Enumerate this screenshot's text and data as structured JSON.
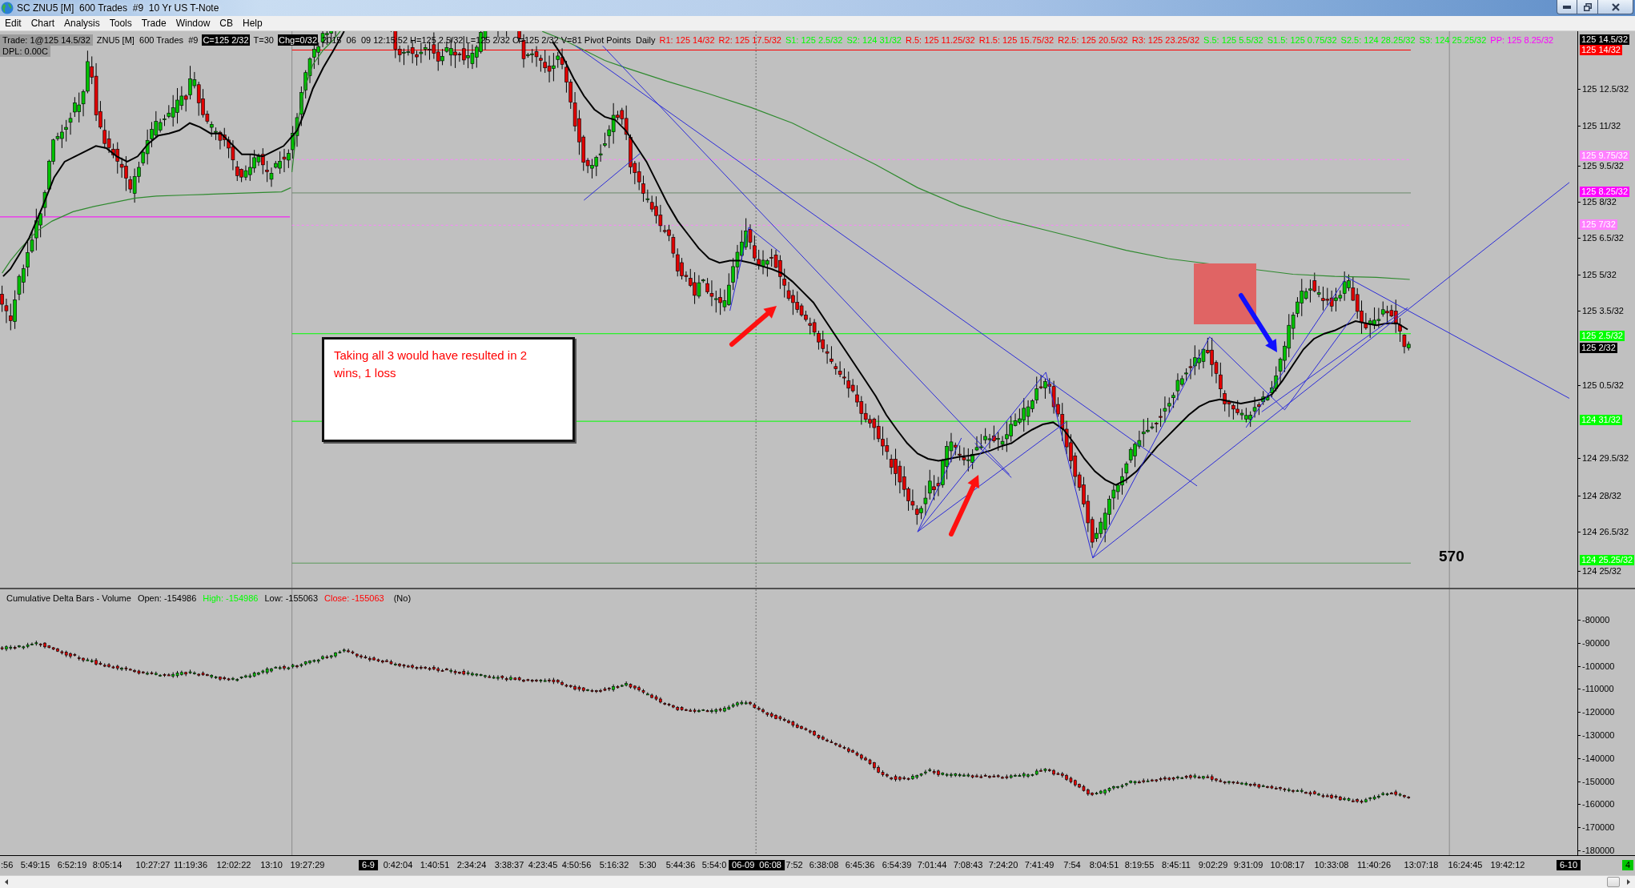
{
  "window": {
    "title": "SC ZNU5 [M]  600 Trades  #9  10 Yr US T-Note"
  },
  "menu": [
    "Edit",
    "Chart",
    "Analysis",
    "Tools",
    "Trade",
    "Window",
    "CB",
    "Help"
  ],
  "price_panel": {
    "trade": "Trade: 1@125 14.5/32",
    "fields": [
      {
        "text": "ZNU5 [M]  600 Trades  #9",
        "highlight": false
      },
      {
        "text": "C=125 2/32",
        "highlight": true
      },
      {
        "text": "T=30",
        "highlight": false
      },
      {
        "text": "Chg=0/32",
        "highlight": true
      },
      {
        "text": "2015  06  09 12:15:52 H=125 2.5/32 L=125 2/32 O=125 2/32 V=81 Pivot Points  Daily",
        "highlight": false
      }
    ],
    "pivots": [
      {
        "text": "R1: 125 14/32",
        "color": "#ff0000"
      },
      {
        "text": "R2: 125 17.5/32",
        "color": "#ff0000"
      },
      {
        "text": "S1: 125 2.5/32",
        "color": "#00ff00"
      },
      {
        "text": "S2: 124 31/32",
        "color": "#00ff00"
      },
      {
        "text": "R.5: 125 11.25/32",
        "color": "#ff0000"
      },
      {
        "text": "R1.5: 125 15.75/32",
        "color": "#ff0000"
      },
      {
        "text": "R2.5: 125 20.5/32",
        "color": "#ff0000"
      },
      {
        "text": "R3: 125 23.25/32",
        "color": "#ff0000"
      },
      {
        "text": "S.5: 125 5.5/32",
        "color": "#00ff00"
      },
      {
        "text": "S1.5: 125 0.75/32",
        "color": "#00ff00"
      },
      {
        "text": "S2.5: 124 28.25/32",
        "color": "#00ff00"
      },
      {
        "text": "S3: 124 25.25/32",
        "color": "#00ff00"
      },
      {
        "text": "PP: 125 8.25/32",
        "color": "#ff00ff"
      }
    ],
    "dpl": "DPL: 0.00C",
    "note": "Taking all 3 would have resulted in 2 wins, 1 loss",
    "counter": "570",
    "axis_ticks": [
      "125 12.5/32",
      "125 11/32",
      "125 9.5/32",
      "125 8/32",
      "125 6.5/32",
      "125 5/32",
      "125 3.5/32",
      "125 0.5/32",
      "124 29.5/32",
      "124 28/32",
      "124 26.5/32",
      "124 25/32"
    ],
    "axis_markers": [
      {
        "text": "125 14.5/32",
        "color": "#000000"
      },
      {
        "text": "125 14/32",
        "color": "#ff0000"
      },
      {
        "text": "125 9.75/32",
        "color": "#ff80ff"
      },
      {
        "text": "125 8.25/32",
        "color": "#ff00ff"
      },
      {
        "text": "125 7/32",
        "color": "#ff80ff"
      },
      {
        "text": "125 2.5/32",
        "color": "#00ff00"
      },
      {
        "text": "125 2/32",
        "color": "#000000"
      },
      {
        "text": "124 31/32",
        "color": "#00ff00"
      },
      {
        "text": "124 25.25/32",
        "color": "#00ff00"
      }
    ]
  },
  "delta_panel": {
    "title": "Cumulative Delta Bars - Volume",
    "readings": [
      {
        "text": "Open: -154986",
        "color": "#000000"
      },
      {
        "text": "High: -154986",
        "color": "#00ff00"
      },
      {
        "text": "Low: -155063",
        "color": "#000000"
      },
      {
        "text": "Close: -155063",
        "color": "#ff0000"
      }
    ],
    "mode": "(No)",
    "axis_ticks": [
      "-80000",
      "-90000",
      "-100000",
      "-110000",
      "-120000",
      "-130000",
      "-140000",
      "-150000",
      "-160000",
      "-170000",
      "-180000"
    ]
  },
  "time_axis": {
    "labels": [
      {
        "text": ":56",
        "highlight": false
      },
      {
        "text": "5:49:15",
        "highlight": false
      },
      {
        "text": "6:52:19",
        "highlight": false
      },
      {
        "text": "8:05:14",
        "highlight": false
      },
      {
        "text": "10:27:27",
        "highlight": false
      },
      {
        "text": "11:19:36",
        "highlight": false
      },
      {
        "text": "12:02:22",
        "highlight": false
      },
      {
        "text": "13:10",
        "highlight": false
      },
      {
        "text": "19:27:29",
        "highlight": false
      },
      {
        "text": "6-9",
        "highlight": true
      },
      {
        "text": "0:42:04",
        "highlight": false
      },
      {
        "text": "1:40:51",
        "highlight": false
      },
      {
        "text": "2:34:24",
        "highlight": false
      },
      {
        "text": "3:38:37",
        "highlight": false
      },
      {
        "text": "4:23:45",
        "highlight": false
      },
      {
        "text": "4:50:56",
        "highlight": false
      },
      {
        "text": "5:16:32",
        "highlight": false
      },
      {
        "text": "5:30",
        "highlight": false
      },
      {
        "text": "5:44:36",
        "highlight": false
      },
      {
        "text": "5:54:0",
        "highlight": false
      },
      {
        "text": "06-09  06:08",
        "highlight": true
      },
      {
        "text": "7:52",
        "highlight": false
      },
      {
        "text": "6:38:08",
        "highlight": false
      },
      {
        "text": "6:45:36",
        "highlight": false
      },
      {
        "text": "6:54:39",
        "highlight": false
      },
      {
        "text": "7:01:44",
        "highlight": false
      },
      {
        "text": "7:08:43",
        "highlight": false
      },
      {
        "text": "7:24:20",
        "highlight": false
      },
      {
        "text": "7:41:49",
        "highlight": false
      },
      {
        "text": "7:54",
        "highlight": false
      },
      {
        "text": "8:04:51",
        "highlight": false
      },
      {
        "text": "8:19:55",
        "highlight": false
      },
      {
        "text": "8:45:11",
        "highlight": false
      },
      {
        "text": "9:02:29",
        "highlight": false
      },
      {
        "text": "9:31:09",
        "highlight": false
      },
      {
        "text": "10:08:17",
        "highlight": false
      },
      {
        "text": "10:33:08",
        "highlight": false
      },
      {
        "text": "11:40:26",
        "highlight": false
      },
      {
        "text": "13:07:18",
        "highlight": false
      },
      {
        "text": "16:24:45",
        "highlight": false
      },
      {
        "text": "19:42:12",
        "highlight": false
      },
      {
        "text": "6-10",
        "highlight": true
      }
    ],
    "badge": "4"
  }
}
